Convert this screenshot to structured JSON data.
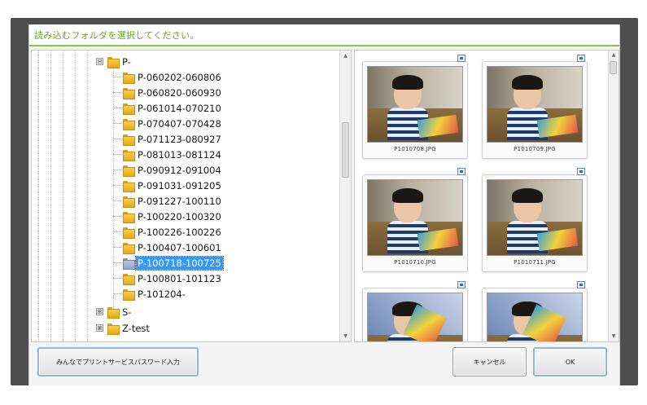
{
  "dialog": {
    "title": "読み込むフォルダを選択してください。"
  },
  "tree": {
    "parent": {
      "label": "P-",
      "expander": "⊟"
    },
    "items": [
      {
        "label": "P-060202-060806"
      },
      {
        "label": "P-060820-060930"
      },
      {
        "label": "P-061014-070210"
      },
      {
        "label": "P-070407-070428"
      },
      {
        "label": "P-071123-080927"
      },
      {
        "label": "P-081013-081124"
      },
      {
        "label": "P-090912-091004"
      },
      {
        "label": "P-091031-091205"
      },
      {
        "label": "P-091227-100110"
      },
      {
        "label": "P-100220-100320"
      },
      {
        "label": "P-100226-100226"
      },
      {
        "label": "P-100407-100601"
      },
      {
        "label": "P-100718-100725",
        "selected": true
      },
      {
        "label": "P-100801-101123"
      },
      {
        "label": "P-101204-"
      }
    ],
    "siblings": [
      {
        "label": "S-",
        "expander": "⊞"
      },
      {
        "label": "Z-test",
        "expander": "⊞"
      }
    ]
  },
  "thumbnails": [
    {
      "caption": "P1010708.JPG"
    },
    {
      "caption": "P1010709.JPG"
    },
    {
      "caption": "P1010710.JPG"
    },
    {
      "caption": "P1010711.JPG"
    },
    {
      "caption": ""
    },
    {
      "caption": ""
    }
  ],
  "scrollbar": {
    "up_glyph": "▲",
    "down_glyph": "▼"
  },
  "buttons": {
    "password": "みんなでプリントサービスパスワード入力",
    "cancel": "キャンセル",
    "ok": "OK"
  },
  "colors": {
    "title_text": "#5fae1f",
    "title_underline": "#8cc63f",
    "selection": "#3399ff",
    "frame": "#4e4e4e"
  }
}
